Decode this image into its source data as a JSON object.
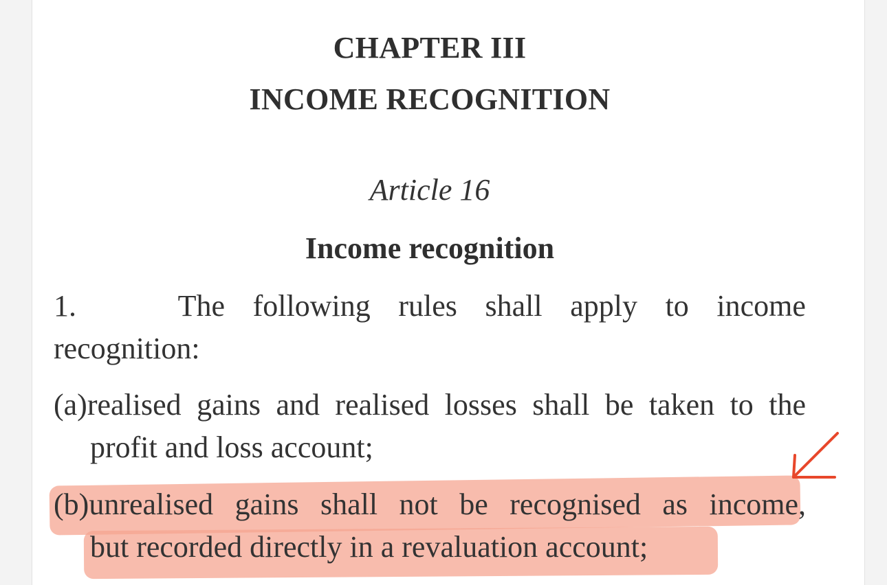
{
  "chapter": {
    "number": "CHAPTER III",
    "title": "INCOME RECOGNITION"
  },
  "article": {
    "number": "Article 16",
    "heading": "Income recognition"
  },
  "paragraph_1": {
    "number": "1.",
    "words_line1": [
      "The",
      "following",
      "rules",
      "shall",
      "apply",
      "to",
      "income"
    ],
    "line2": "recognition:"
  },
  "items": [
    {
      "label": "(a)",
      "line1": "realised gains and realised losses shall be taken to the",
      "line2": "profit and loss account;"
    },
    {
      "label": "(b)",
      "line1": "unrealised gains shall not be recognised as income,",
      "line2": "but recorded directly in a revaluation account;"
    }
  ],
  "annotation": {
    "highlight_color": "#f6a592",
    "arrow_color": "#e8472b",
    "arrow_icon": "arrow-down-left-icon"
  }
}
